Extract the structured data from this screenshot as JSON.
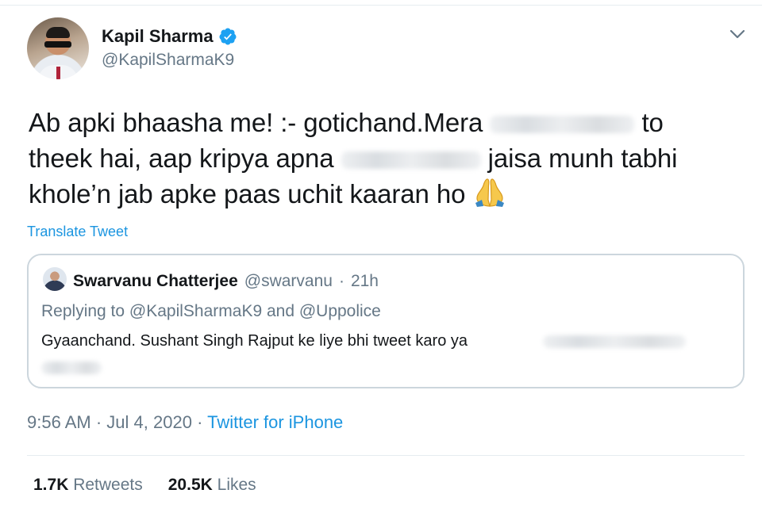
{
  "tweet": {
    "author_name": "Kapil Sharma",
    "author_handle": "@KapilSharmaK9",
    "text_line1_a": "Ab apki bhaasha me! :- gotichand.Mera",
    "text_line1_b": "to",
    "text_line2_a": "theek hai, aap kripya apna",
    "text_line2_b": "jaisa munh tabhi",
    "text_line3": "khole’n jab apke paas uchit kaaran ho",
    "translate_label": "Translate Tweet",
    "time": "9:56 AM",
    "date": "Jul 4, 2020",
    "source": "Twitter for iPhone",
    "retweets_count": "1.7K",
    "retweets_label": "Retweets",
    "likes_count": "20.5K",
    "likes_label": "Likes"
  },
  "quoted_tweet": {
    "author_name": "Swarvanu Chatterjee",
    "author_handle": "@swarvanu",
    "age": "21h",
    "replying_to": "Replying to @KapilSharmaK9 and @Uppolice",
    "text": "Gyaanchand. Sushant Singh Rajput ke liye bhi tweet karo ya"
  },
  "icons": {
    "verified": "verified-badge-icon",
    "menu": "chevron-down-icon",
    "emoji": "folded-hands-emoji"
  },
  "colors": {
    "link": "#1b95e0",
    "muted": "#657786",
    "text": "#14171a"
  }
}
